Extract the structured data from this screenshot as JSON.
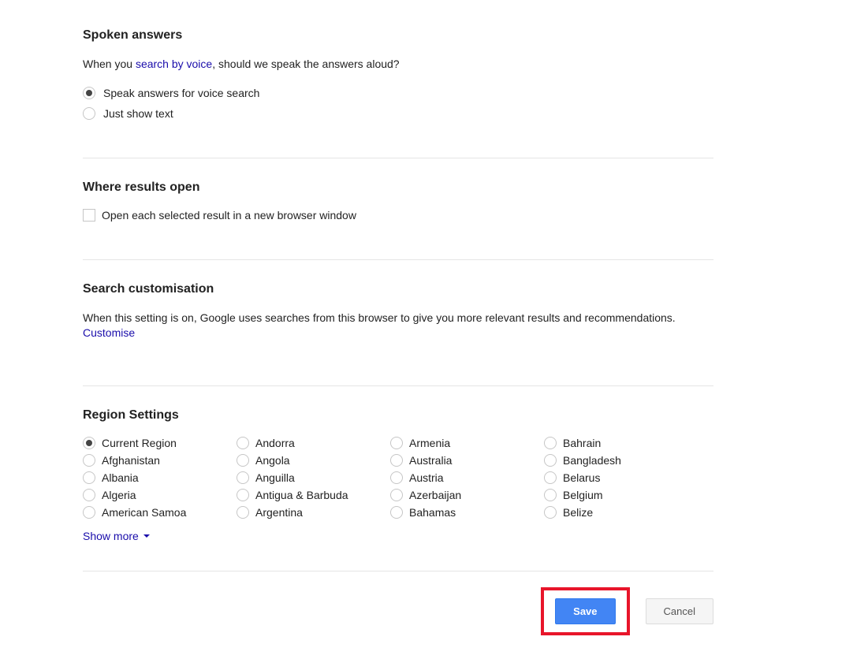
{
  "spoken": {
    "title": "Spoken answers",
    "desc_before": "When you ",
    "link_text": "search by voice",
    "desc_after": ", should we speak the answers aloud?",
    "options": [
      {
        "label": "Speak answers for voice search",
        "selected": true
      },
      {
        "label": "Just show text",
        "selected": false
      }
    ]
  },
  "where": {
    "title": "Where results open",
    "checkbox_label": "Open each selected result in a new browser window",
    "checked": false
  },
  "customisation": {
    "title": "Search customisation",
    "desc_before": "When this setting is on, Google uses searches from this browser to give you more relevant results and recommendations. ",
    "link_text": "Customise"
  },
  "region": {
    "title": "Region Settings",
    "items": [
      {
        "label": "Current Region",
        "selected": true
      },
      {
        "label": "Andorra",
        "selected": false
      },
      {
        "label": "Armenia",
        "selected": false
      },
      {
        "label": "Bahrain",
        "selected": false
      },
      {
        "label": "Afghanistan",
        "selected": false
      },
      {
        "label": "Angola",
        "selected": false
      },
      {
        "label": "Australia",
        "selected": false
      },
      {
        "label": "Bangladesh",
        "selected": false
      },
      {
        "label": "Albania",
        "selected": false
      },
      {
        "label": "Anguilla",
        "selected": false
      },
      {
        "label": "Austria",
        "selected": false
      },
      {
        "label": "Belarus",
        "selected": false
      },
      {
        "label": "Algeria",
        "selected": false
      },
      {
        "label": "Antigua & Barbuda",
        "selected": false
      },
      {
        "label": "Azerbaijan",
        "selected": false
      },
      {
        "label": "Belgium",
        "selected": false
      },
      {
        "label": "American Samoa",
        "selected": false
      },
      {
        "label": "Argentina",
        "selected": false
      },
      {
        "label": "Bahamas",
        "selected": false
      },
      {
        "label": "Belize",
        "selected": false
      }
    ],
    "show_more": "Show more"
  },
  "buttons": {
    "save": "Save",
    "cancel": "Cancel"
  }
}
